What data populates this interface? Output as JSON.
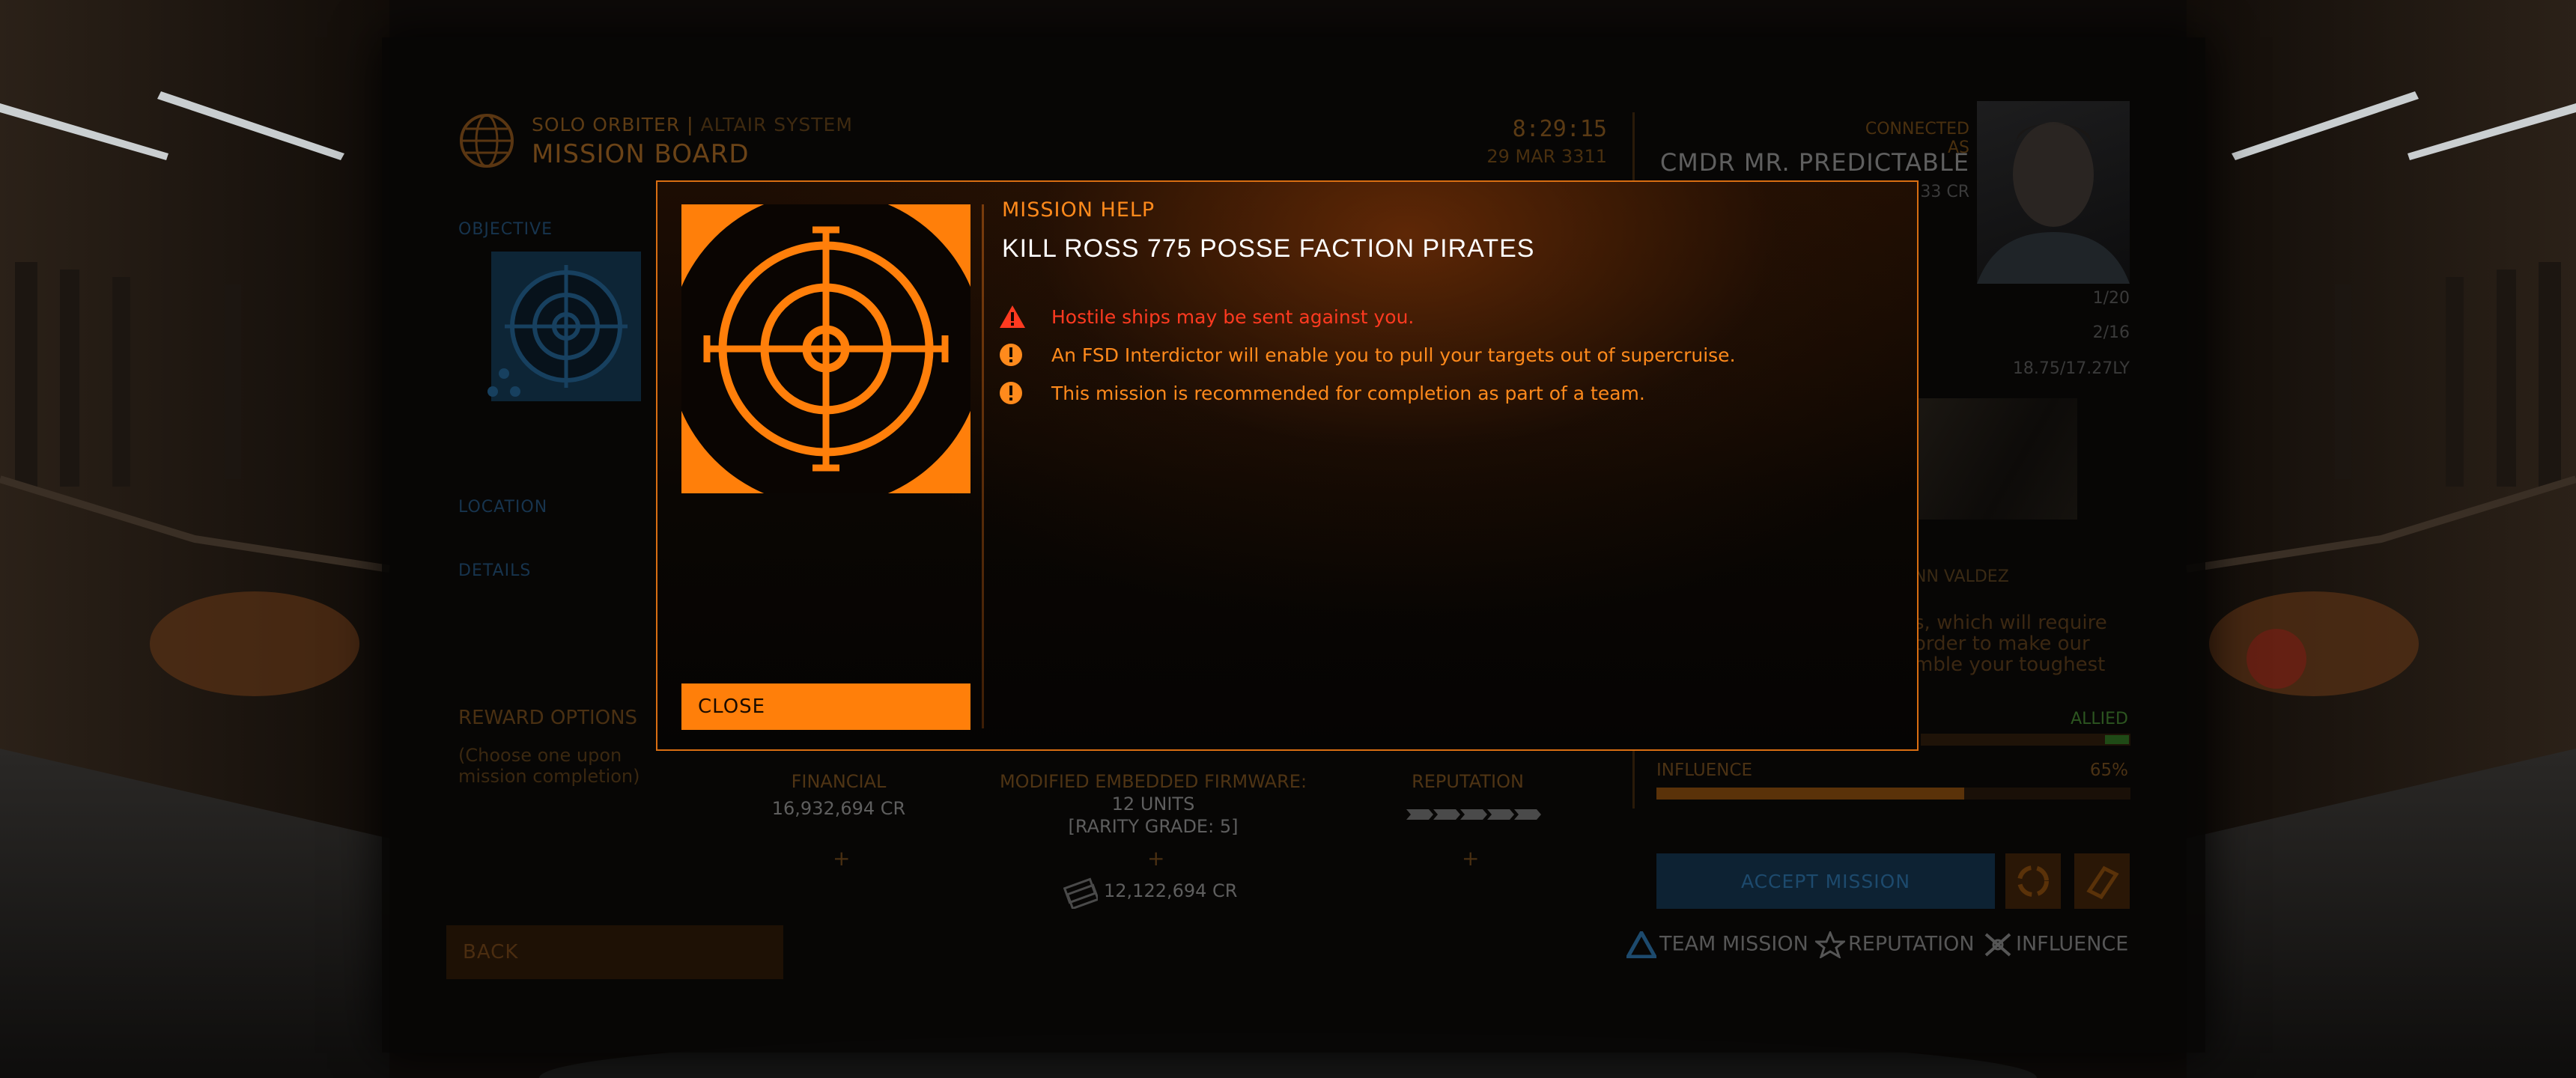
{
  "header": {
    "location": "SOLO ORBITER",
    "system": "ALTAIR SYSTEM",
    "separator": "|",
    "title": "MISSION BOARD",
    "time": "8:29:15",
    "date": "29 MAR 3311"
  },
  "left_panel": {
    "objective_label": "OBJECTIVE",
    "location_label": "LOCATION",
    "details_label": "DETAILS"
  },
  "rewards": {
    "title": "REWARD OPTIONS",
    "subtitle": "(Choose one upon mission completion)",
    "options": [
      {
        "label": "FINANCIAL",
        "value": "16,932,694 CR"
      },
      {
        "label": "MODIFIED EMBEDDED FIRMWARE:",
        "value": "12 UNITS",
        "extra": "[RARITY GRADE: 5]",
        "credits": "12,122,694 CR"
      },
      {
        "label": "REPUTATION",
        "pips": 5
      }
    ],
    "plus": "+"
  },
  "commander": {
    "connected_label": "CONNECTED AS",
    "name": "CMDR MR. PREDICTABLE",
    "credits": "33 CR",
    "stat1": "1/20",
    "stat2": "2/16",
    "stat3": "18.75/17.27LY"
  },
  "mission_giver": {
    "name": "NN VALDEZ",
    "text": "s, which will require order to make our mble your toughest"
  },
  "standing": {
    "allied_label": "ALLIED",
    "influence_label": "INFLUENCE",
    "influence_pct": "65%",
    "influence_value": 0.65,
    "allied_value": 1.0
  },
  "actions": {
    "accept": "ACCEPT MISSION",
    "back": "BACK"
  },
  "legend": {
    "team": "TEAM MISSION",
    "reputation": "REPUTATION",
    "influence": "INFLUENCE"
  },
  "modal": {
    "label": "MISSION HELP",
    "title": "KILL ROSS 775 POSSE FACTION PIRATES",
    "close": "CLOSE",
    "notes": [
      {
        "type": "warning",
        "icon": "warning-triangle-icon",
        "text": "Hostile ships may be sent against you."
      },
      {
        "type": "info",
        "icon": "exclamation-circle-icon",
        "text": "An FSD Interdictor will enable you to pull your targets out of supercruise."
      },
      {
        "type": "info",
        "icon": "exclamation-circle-icon",
        "text": "This mission is recommended for completion as part of a team."
      }
    ]
  },
  "colors": {
    "accent": "#ff7f0a",
    "warning": "#ff3a20",
    "text_orange": "#ff8a1c",
    "title_white": "#ffffff"
  }
}
